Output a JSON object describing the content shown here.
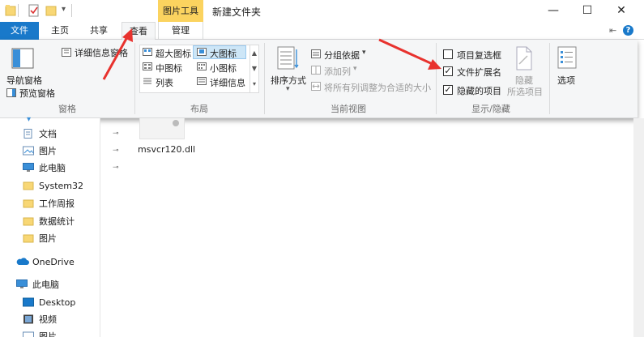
{
  "titlebar": {
    "context_group": "图片工具",
    "title": "新建文件夹",
    "minimize": "—",
    "maximize": "☐",
    "close": "✕"
  },
  "tabs": {
    "file": "文件",
    "home": "主页",
    "share": "共享",
    "view": "查看",
    "manage": "管理"
  },
  "ribbon": {
    "pane_group": {
      "nav_pane": "导航窗格",
      "preview_pane": "预览窗格",
      "details_pane": "详细信息窗格",
      "label": "窗格"
    },
    "layout_group": {
      "items": [
        "超大图标",
        "大图标",
        "中图标",
        "小图标",
        "列表",
        "详细信息"
      ],
      "label": "布局"
    },
    "current_view_group": {
      "sort_by": "排序方式",
      "group_by": "分组依据",
      "add_columns": "添加列",
      "fit_columns": "将所有列调整为合适的大小",
      "label": "当前视图"
    },
    "show_hide_group": {
      "item_checkboxes": "项目复选框",
      "file_extensions": "文件扩展名",
      "hidden_items": "隐藏的项目",
      "hide_selected_line1": "隐藏",
      "hide_selected_line2": "所选项目",
      "item_checkboxes_checked": false,
      "file_extensions_checked": true,
      "hidden_items_checked": true,
      "label": "显示/隐藏"
    },
    "options": "选项"
  },
  "nav": {
    "items": [
      {
        "label": "文档",
        "pinned": true
      },
      {
        "label": "图片",
        "pinned": true
      },
      {
        "label": "此电脑",
        "pinned": true
      },
      {
        "label": "System32",
        "pinned": false
      },
      {
        "label": "工作周报",
        "pinned": false
      },
      {
        "label": "数据统计",
        "pinned": false
      },
      {
        "label": "图片",
        "pinned": false
      },
      {
        "label": "OneDrive",
        "pinned": false
      },
      {
        "label": "此电脑",
        "pinned": false
      },
      {
        "label": "Desktop",
        "pinned": false
      },
      {
        "label": "视频",
        "pinned": false
      },
      {
        "label": "图片",
        "pinned": false
      }
    ],
    "pin_glyph": "📌"
  },
  "file": {
    "name": "msvcr120.dll"
  },
  "colors": {
    "accent": "#1979ca",
    "context_tab": "#fbd35f",
    "arrow": "#e8322e",
    "folder": "#f8d775"
  }
}
